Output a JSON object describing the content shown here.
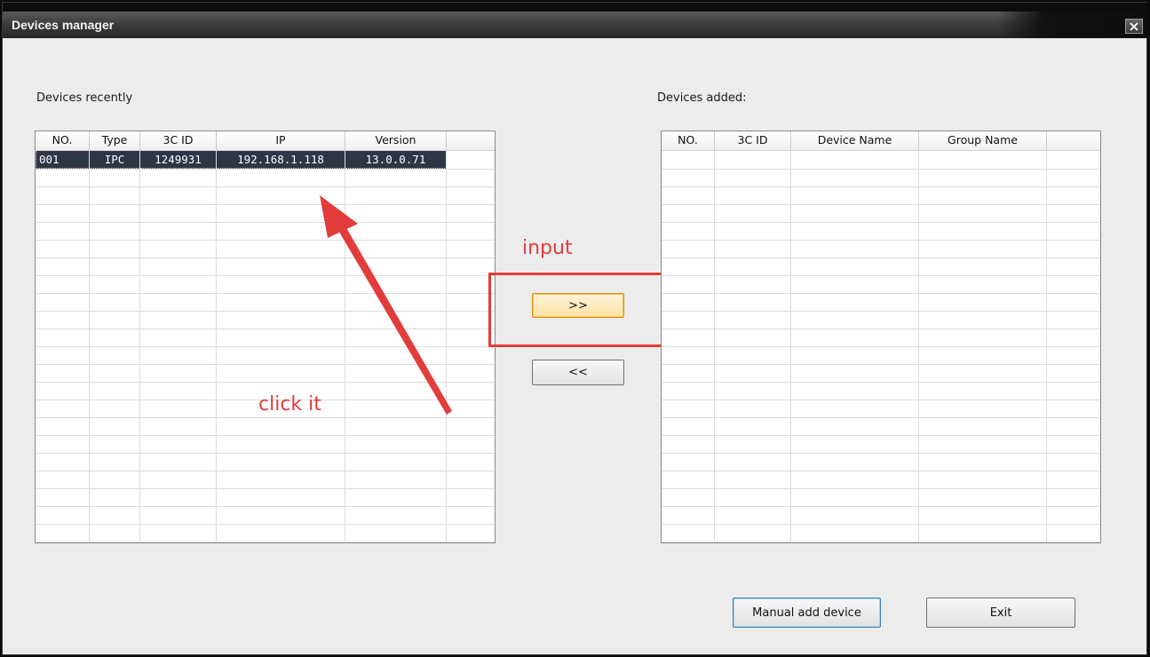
{
  "window": {
    "title": "Devices manager"
  },
  "left_panel": {
    "label": "Devices recently",
    "columns": [
      "NO.",
      "Type",
      "3C ID",
      "IP",
      "Version"
    ],
    "rows": [
      {
        "no": "001",
        "type": "IPC",
        "id": "1249931",
        "ip": "192.168.1.118",
        "version": "13.0.0.71"
      }
    ]
  },
  "right_panel": {
    "label": "Devices added:",
    "columns": [
      "NO.",
      "3C ID",
      "Device Name",
      "Group Name"
    ]
  },
  "buttons": {
    "add": ">>",
    "remove": "<<",
    "manual_add": "Manual add device",
    "exit": "Exit"
  },
  "annotations": {
    "input_label": "input",
    "click_label": "click it",
    "color": "#e23c3c"
  },
  "icons": {
    "close": "close-icon"
  }
}
